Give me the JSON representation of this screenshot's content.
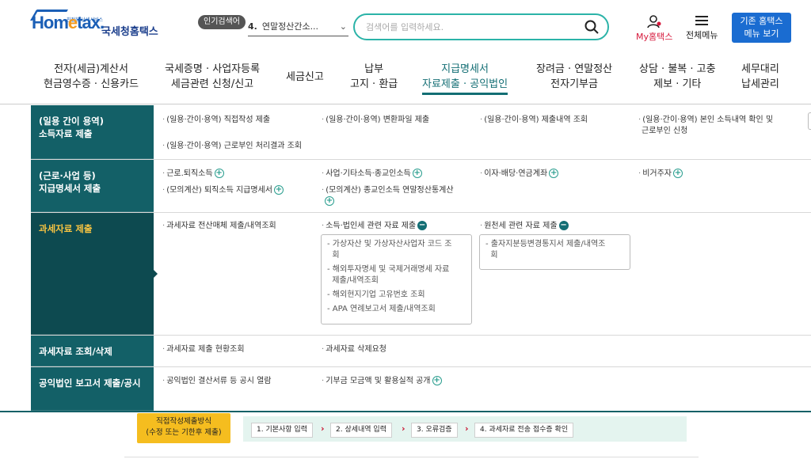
{
  "header": {
    "logo_small": "친절한 납세서비스",
    "logo_text": "Hometax",
    "logo_name": "국세청홈택스",
    "popular_badge": "인기검색어",
    "popular_num": "4.",
    "popular_text": "연말정산간소...",
    "search_placeholder": "검색어를 입력하세요.",
    "my_label": "My홈택스",
    "all_menu_label": "전체메뉴",
    "old_btn_line1": "기존 홈택스",
    "old_btn_line2": "메뉴 보기"
  },
  "gnb": {
    "items": [
      {
        "l1": "전자(세금)계산서",
        "l2": "현금영수증 · 신용카드"
      },
      {
        "l1": "국세증명 · 사업자등록",
        "l2": "세금관련 신청/신고"
      },
      {
        "l1": "세금신고",
        "l2": ""
      },
      {
        "l1": "납부",
        "l2": "고지 · 환급"
      },
      {
        "l1": "지급명세서",
        "l2": "자료제출 · 공익법인"
      },
      {
        "l1": "장려금 · 연말정산",
        "l2": "전자기부금"
      },
      {
        "l1": "상담 · 불복 · 고충",
        "l2": "제보 · 기타"
      },
      {
        "l1": "세무대리",
        "l2": "납세관리"
      }
    ]
  },
  "mega": {
    "rows": [
      {
        "head1": "(일용 간이 용역)",
        "head2": "소득자료 제출",
        "links": [
          "(일용·간이·용역) 직접작성 제출",
          "(일용·간이·용역) 변환파일 제출",
          "(일용·간이·용역) 제출내역 조회",
          "(일용·간이·용역) 본인 소득내역 확인 및",
          "근로부인 신청",
          "(일용·간이·용역) 근로부인 처리결과 조회"
        ]
      },
      {
        "head1": "(근로·사업 등)",
        "head2": "지급명세서 제출",
        "links": [
          "근로.퇴직소득",
          "사업·기타소득·종교인소득",
          "이자·배당·연금계좌",
          "비거주자",
          "(모의계산) 퇴직소득 지급명세서",
          "(모의계산) 종교인소득 연말정산통계산"
        ]
      },
      {
        "head1": "과세자료 제출",
        "links": [
          "과세자료 전산매체 제출/내역조회",
          "소득·법인세 관련 자료 제출",
          "원천세 관련 자료 제출"
        ],
        "sub_a": [
          "가상자산 및 가상자산사업자 코드 조",
          "회",
          "해외투자명세 및 국제거래명세 자료",
          "제출/내역조회",
          "해외현지기업 고유번호 조회",
          "APA 연례보고서 제출/내역조회"
        ],
        "sub_b": [
          "출자지분등변경통지서 제출/내역조",
          "회"
        ]
      },
      {
        "head1": "과세자료 조회/삭제",
        "links": [
          "과세자료 제출 현황조회",
          "과세자료 삭제요청"
        ]
      },
      {
        "head1": "공익법인 보고서 제출/공시",
        "links": [
          "공익법인 결산서류 등 공시 열람",
          "기부금 모금액 및 활용실적 공개"
        ]
      }
    ]
  },
  "steps": {
    "label1": "직접작성제출방식",
    "label2": "(수정 또는 기한후 제출)",
    "items": [
      "1. 기본사항 입력",
      "2. 상세내역 입력",
      "3. 오류검증",
      "4. 과세자료 전송 접수증 확인"
    ]
  },
  "colors": {
    "accent": "#136e74",
    "dark_panel": "#136067",
    "active_panel": "#0d4a50",
    "highlight": "#f6c342",
    "button_blue": "#1a6cd1"
  }
}
